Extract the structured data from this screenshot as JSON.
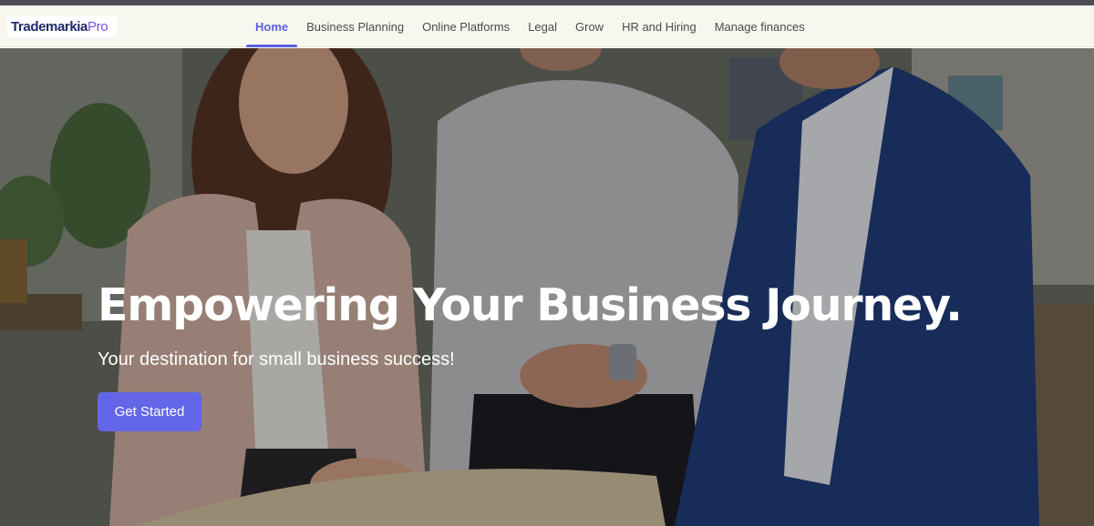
{
  "logo": {
    "brand": "Trademarkia",
    "suffix": "Pro"
  },
  "nav": {
    "items": [
      {
        "label": "Home",
        "active": true
      },
      {
        "label": "Business Planning",
        "active": false
      },
      {
        "label": "Online Platforms",
        "active": false
      },
      {
        "label": "Legal",
        "active": false
      },
      {
        "label": "Grow",
        "active": false
      },
      {
        "label": "HR and Hiring",
        "active": false
      },
      {
        "label": "Manage finances",
        "active": false
      }
    ]
  },
  "hero": {
    "title": "Empowering Your Business Journey.",
    "subtitle": "Your destination for small business success!",
    "cta_label": "Get Started"
  },
  "colors": {
    "accent": "#6466e9",
    "nav_active": "#5b5fe0",
    "nav_background": "#f7f7f0",
    "top_strip": "#4b4e55"
  }
}
